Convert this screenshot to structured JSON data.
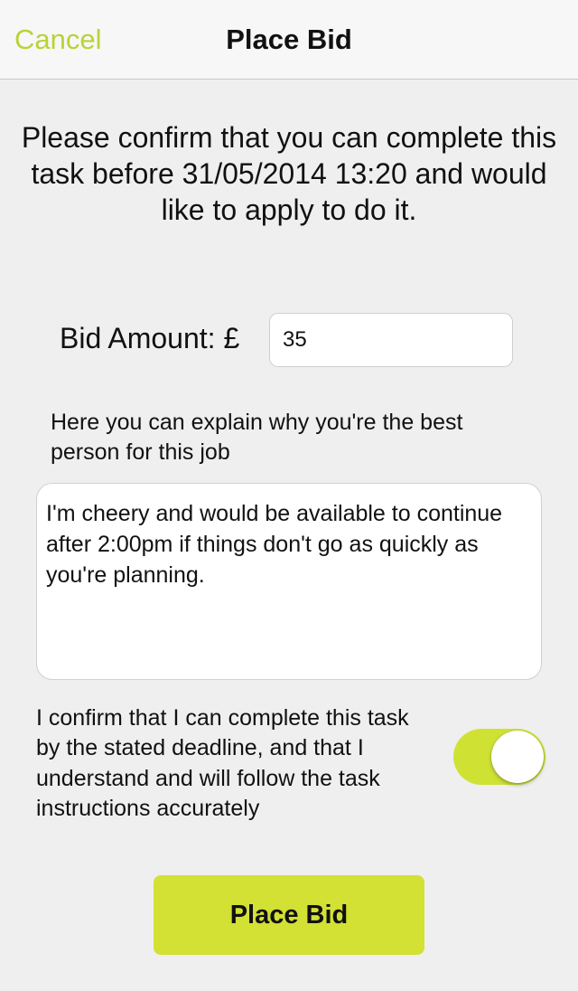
{
  "navbar": {
    "cancel_label": "Cancel",
    "title": "Place Bid"
  },
  "confirm_message": "Please confirm that you can complete this task before 31/05/2014 13:20 and would like to apply to do it.",
  "bid": {
    "label": "Bid Amount: £",
    "value": "35"
  },
  "explain": {
    "label": "Here you can explain why you're the best person for this job",
    "value": "I'm cheery and would be available to continue after 2:00pm if things don't go as quickly as you're planning."
  },
  "agreement": {
    "text": "I confirm that I can complete this task by the stated deadline, and that I understand and will follow the task instructions accurately",
    "toggle_on": true
  },
  "submit_label": "Place Bid",
  "colors": {
    "accent": "#b9d335",
    "button": "#d2e133",
    "toggle": "#cfe234",
    "background": "#efefef"
  }
}
